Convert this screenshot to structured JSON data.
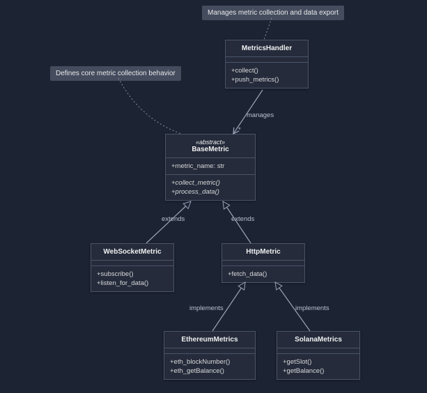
{
  "notes": {
    "note1": "Manages metric collection and data export",
    "note2": "Defines core metric collection behavior"
  },
  "classes": {
    "MetricsHandler": {
      "name": "MetricsHandler",
      "methods": [
        "+collect()",
        "+push_metrics()"
      ]
    },
    "BaseMetric": {
      "stereo": "«abstract»",
      "name": "BaseMetric",
      "attrs": [
        "+metric_name: str"
      ],
      "methods": [
        "+collect_metric()",
        "+process_data()"
      ]
    },
    "WebSocketMetric": {
      "name": "WebSocketMetric",
      "methods": [
        "+subscribe()",
        "+listen_for_data()"
      ]
    },
    "HttpMetric": {
      "name": "HttpMetric",
      "methods": [
        "+fetch_data()"
      ]
    },
    "EthereumMetrics": {
      "name": "EthereumMetrics",
      "methods": [
        "+eth_blockNumber()",
        "+eth_getBalance()"
      ]
    },
    "SolanaMetrics": {
      "name": "SolanaMetrics",
      "methods": [
        "+getSlot()",
        "+getBalance()"
      ]
    }
  },
  "labels": {
    "manages": "manages",
    "star": "*",
    "extends1": "extends",
    "extends2": "extends",
    "implements1": "implements",
    "implements2": "implements"
  },
  "chart_data": {
    "type": "diagram",
    "diagram_type": "uml_class",
    "classes": [
      {
        "name": "MetricsHandler",
        "stereotype": null,
        "attributes": [],
        "methods": [
          "+collect()",
          "+push_metrics()"
        ]
      },
      {
        "name": "BaseMetric",
        "stereotype": "abstract",
        "attributes": [
          "+metric_name: str"
        ],
        "methods": [
          "+collect_metric()",
          "+process_data()"
        ]
      },
      {
        "name": "WebSocketMetric",
        "stereotype": null,
        "attributes": [],
        "methods": [
          "+subscribe()",
          "+listen_for_data()"
        ]
      },
      {
        "name": "HttpMetric",
        "stereotype": null,
        "attributes": [],
        "methods": [
          "+fetch_data()"
        ]
      },
      {
        "name": "EthereumMetrics",
        "stereotype": null,
        "attributes": [],
        "methods": [
          "+eth_blockNumber()",
          "+eth_getBalance()"
        ]
      },
      {
        "name": "SolanaMetrics",
        "stereotype": null,
        "attributes": [],
        "methods": [
          "+getSlot()",
          "+getBalance()"
        ]
      }
    ],
    "relationships": [
      {
        "from": "MetricsHandler",
        "to": "BaseMetric",
        "type": "association",
        "label": "manages",
        "multiplicity_to": "*"
      },
      {
        "from": "WebSocketMetric",
        "to": "BaseMetric",
        "type": "generalization",
        "label": "extends"
      },
      {
        "from": "HttpMetric",
        "to": "BaseMetric",
        "type": "generalization",
        "label": "extends"
      },
      {
        "from": "EthereumMetrics",
        "to": "HttpMetric",
        "type": "generalization",
        "label": "implements"
      },
      {
        "from": "SolanaMetrics",
        "to": "HttpMetric",
        "type": "generalization",
        "label": "implements"
      }
    ],
    "notes": [
      {
        "text": "Manages metric collection and data export",
        "attached_to": "MetricsHandler"
      },
      {
        "text": "Defines core metric collection behavior",
        "attached_to": "BaseMetric"
      }
    ]
  }
}
